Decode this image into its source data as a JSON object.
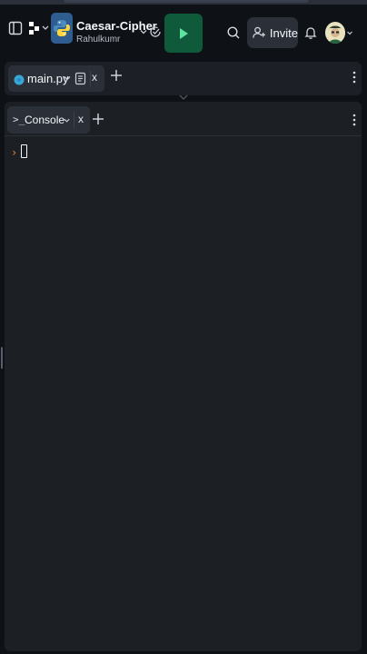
{
  "header": {
    "project_title": "Caesar-Cipher",
    "project_owner": "Rahulkumr",
    "invite_label": "Invite",
    "icons": [
      "sidebar-icon",
      "repl-menu-icon",
      "python-logo-icon",
      "chevron-down-icon",
      "status-check-icon",
      "play-icon",
      "search-icon",
      "user-plus-icon",
      "bell-icon",
      "avatar"
    ]
  },
  "editor_tabs": {
    "active": {
      "label": "main.py",
      "close": "x"
    }
  },
  "console": {
    "tab_icon": ">_",
    "tab_label": "Console",
    "close": "x",
    "prompt": "›"
  },
  "colors": {
    "run_button": "#0f5a3a",
    "prompt_accent": "#e3872a",
    "pane_bg": "#1c2026",
    "app_bg": "#0e1116"
  }
}
